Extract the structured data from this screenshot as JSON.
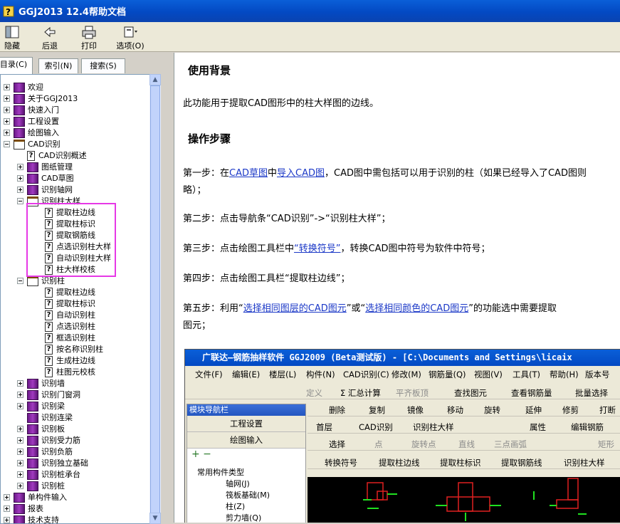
{
  "window": {
    "title": "GGJ2013 12.4帮助文档"
  },
  "toolbar": {
    "buttons": [
      {
        "label": "隐藏",
        "icon": "hide-icon"
      },
      {
        "label": "后退",
        "icon": "back-arrow-icon"
      },
      {
        "label": "打印",
        "icon": "printer-icon"
      },
      {
        "label": "选项(O)",
        "icon": "options-icon"
      }
    ]
  },
  "tabs": [
    {
      "label": "目录(C)"
    },
    {
      "label": "索引(N)"
    },
    {
      "label": "搜索(S)"
    }
  ],
  "tree": [
    {
      "label": "欢迎"
    },
    {
      "label": "关于GGJ2013"
    },
    {
      "label": "快速入门"
    },
    {
      "label": "工程设置"
    },
    {
      "label": "绘图输入"
    },
    {
      "label": "CAD识别"
    },
    {
      "label": "CAD识别概述"
    },
    {
      "label": "图纸管理"
    },
    {
      "label": "CAD草图"
    },
    {
      "label": "识别轴网"
    },
    {
      "label": "识别柱大样"
    },
    {
      "label": "提取柱边线"
    },
    {
      "label": "提取柱标识"
    },
    {
      "label": "提取钢筋线"
    },
    {
      "label": "点选识别柱大样"
    },
    {
      "label": "自动识别柱大样"
    },
    {
      "label": "柱大样校核"
    },
    {
      "label": "识别柱"
    },
    {
      "label": "提取柱边线"
    },
    {
      "label": "提取柱标识"
    },
    {
      "label": "自动识别柱"
    },
    {
      "label": "点选识别柱"
    },
    {
      "label": "框选识别柱"
    },
    {
      "label": "按名称识别柱"
    },
    {
      "label": "生成柱边线"
    },
    {
      "label": "柱图元校核"
    },
    {
      "label": "识别墙"
    },
    {
      "label": "识别门窗洞"
    },
    {
      "label": "识别梁"
    },
    {
      "label": "识别连梁"
    },
    {
      "label": "识别板"
    },
    {
      "label": "识别受力筋"
    },
    {
      "label": "识别负筋"
    },
    {
      "label": "识别独立基础"
    },
    {
      "label": "识别桩承台"
    },
    {
      "label": "识别桩"
    },
    {
      "label": "单构件输入"
    },
    {
      "label": "报表"
    },
    {
      "label": "技术支持"
    }
  ],
  "content": {
    "h1": "使用背景",
    "intro": "此功能用于提取CAD图形中的柱大样图的边线。",
    "h2": "操作步骤",
    "s1a": "第一步：在",
    "s1l1": "CAD草图",
    "s1b": "中",
    "s1l2": "导入CAD图",
    "s1c": "，CAD图中需包括可以用于识别的柱（如果已经导入了CAD图则",
    "s1d": "略）；",
    "s2": "第二步：点击导航条“CAD识别”->“识别柱大样”；",
    "s3a": "第三步：点击绘图工具栏中",
    "s3l": "“转换符号”",
    "s3b": "，转换CAD图中符号为软件中符号；",
    "s4": "第四步：点击绘图工具栏“提取柱边线”；",
    "s5a": "第五步：利用“",
    "s5l1": "选择相同图层的CAD图元",
    "s5b": "”或“",
    "s5l2": "选择相同颜色的CAD图元",
    "s5c": "”的功能选中需要提取",
    "s5d": "图元；"
  },
  "shot": {
    "title": "广联达—钢筋抽样软件 GGJ2009 (Beta测试版) - [C:\\Documents and Settings\\licaix",
    "menu": [
      "文件(F)",
      "编辑(E)",
      "楼层(L)",
      "构件(N)",
      "CAD识别(C)",
      "修改(M)",
      "钢筋量(Q)",
      "视图(V)",
      "工具(T)",
      "帮助(H)",
      "版本号"
    ],
    "tb1": [
      "定义",
      "Σ 汇总计算",
      "平齐板顶",
      "查找图元",
      "查看钢筋量",
      "批量选择"
    ],
    "nav_title": "模块导航栏",
    "nav_btn1": "工程设置",
    "nav_btn2": "绘图输入",
    "tb2": [
      "删除",
      "复制",
      "镜像",
      "移动",
      "旋转",
      "延伸",
      "修剪",
      "打断"
    ],
    "floor": "首层",
    "cad": "CAD识别",
    "col": "识别柱大样",
    "attr": "属性",
    "edit_rebar": "编辑钢筋",
    "tb3": [
      "选择",
      "点",
      "旋转点",
      "直线",
      "三点画弧",
      "矩形"
    ],
    "tb4": [
      "转换符号",
      "提取柱边线",
      "提取柱标识",
      "提取钢筋线",
      "识别柱大样"
    ],
    "tree": [
      "常用构件类型",
      "轴网(J)",
      "筏板基础(M)",
      "柱(Z)",
      "剪力墙(Q)"
    ]
  }
}
